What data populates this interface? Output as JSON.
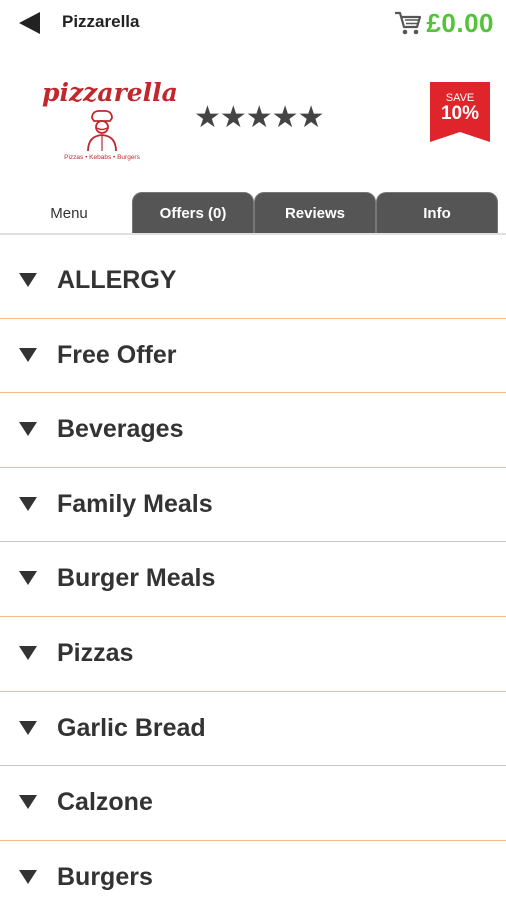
{
  "topbar": {
    "title": "Pizzarella",
    "back_icon": "back-arrow-icon",
    "cart_icon": "cart-icon",
    "cart_total": "£0.00",
    "cart_total_color": "#53c43a"
  },
  "restaurant": {
    "logo_text": "pizzarella",
    "logo_tagline": "Pizzas • Kebabs • Burgers",
    "rating_stars": "★★★★★",
    "rating_value": 5,
    "rating_max": 5,
    "save_badge": {
      "label": "SAVE",
      "value": "10%",
      "color": "#e0242b"
    }
  },
  "tabs": [
    {
      "label": "Menu",
      "active": true
    },
    {
      "label": "Offers (0)",
      "active": false
    },
    {
      "label": "Reviews",
      "active": false
    },
    {
      "label": "Info",
      "active": false
    }
  ],
  "menu": {
    "divider_color": "#f4b88e",
    "categories": [
      "ALLERGY",
      "Free Offer",
      "Beverages",
      "Family Meals",
      "Burger Meals",
      "Pizzas",
      "Garlic Bread",
      "Calzone",
      "Burgers"
    ]
  }
}
